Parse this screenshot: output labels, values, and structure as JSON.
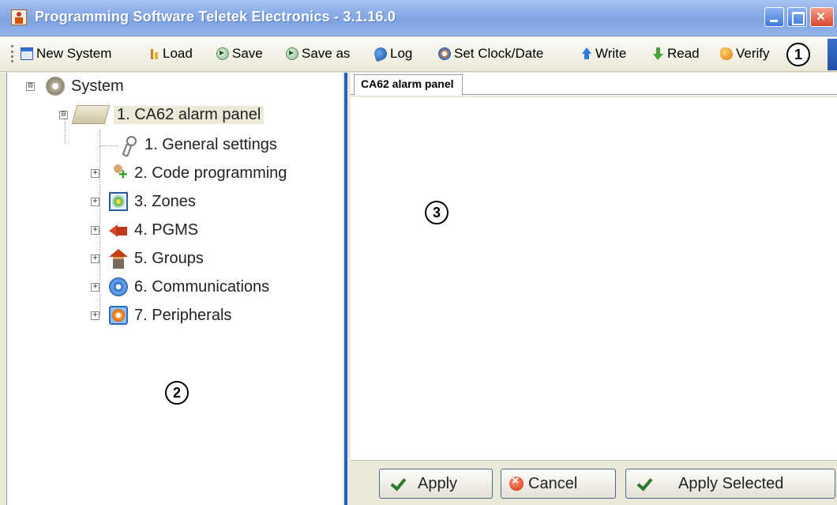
{
  "window": {
    "title": "Programming Software Teletek Electronics - 3.1.16.0"
  },
  "toolbar": {
    "items": [
      {
        "label": "New System",
        "icon": "new-system-icon"
      },
      {
        "label": "Load",
        "icon": "load-icon"
      },
      {
        "label": "Save",
        "icon": "save-icon"
      },
      {
        "label": "Save as",
        "icon": "save-as-icon"
      },
      {
        "label": "Log",
        "icon": "log-icon"
      },
      {
        "label": "Set Clock/Date",
        "icon": "clock-icon"
      },
      {
        "label": "Write",
        "icon": "write-arrow-up-icon"
      },
      {
        "label": "Read",
        "icon": "read-arrow-down-icon"
      },
      {
        "label": "Verify",
        "icon": "verify-icon"
      }
    ]
  },
  "callouts": {
    "toolbar": "1",
    "tree": "2",
    "content": "3"
  },
  "tree": {
    "root": {
      "label": "System",
      "expander": "⊟"
    },
    "panel": {
      "label": "1. CA62 alarm panel",
      "expander": "⊟"
    },
    "children": [
      {
        "label": "1. General settings",
        "expander": ""
      },
      {
        "label": "2. Code programming",
        "expander": "+"
      },
      {
        "label": "3. Zones",
        "expander": "+"
      },
      {
        "label": "4. PGMS",
        "expander": "+"
      },
      {
        "label": "5. Groups",
        "expander": "+"
      },
      {
        "label": "6. Communications",
        "expander": "+"
      },
      {
        "label": "7. Peripherals",
        "expander": "+"
      }
    ]
  },
  "content": {
    "tab_label": "CA62 alarm panel"
  },
  "buttons": {
    "apply": "Apply",
    "cancel": "Cancel",
    "apply_selected": "Apply Selected"
  },
  "colors": {
    "title_bar": "#7ea3e2",
    "splitter_accent": "#2060c8",
    "window_bg": "#ece9d8"
  }
}
